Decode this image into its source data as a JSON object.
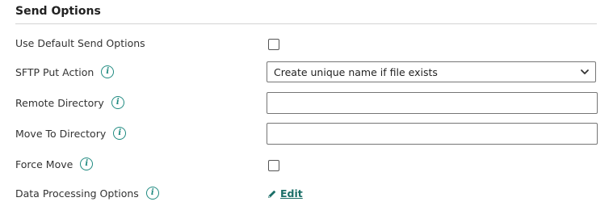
{
  "section": {
    "title": "Send Options"
  },
  "rows": {
    "use_default": {
      "label": "Use Default Send Options",
      "checked": false
    },
    "sftp_put_action": {
      "label": "SFTP Put Action",
      "icon": "info-icon",
      "selected": "Create unique name if file exists"
    },
    "remote_directory": {
      "label": "Remote Directory",
      "icon": "info-icon",
      "value": ""
    },
    "move_to_directory": {
      "label": "Move To Directory",
      "icon": "info-icon",
      "value": ""
    },
    "force_move": {
      "label": "Force Move",
      "icon": "info-icon",
      "checked": false
    },
    "data_processing": {
      "label": "Data Processing Options",
      "icon": "info-icon",
      "link_label": "Edit",
      "link_icon": "pencil-icon"
    }
  },
  "colors": {
    "accent": "#1f8a80",
    "link": "#1a6e67",
    "border": "#767676"
  }
}
